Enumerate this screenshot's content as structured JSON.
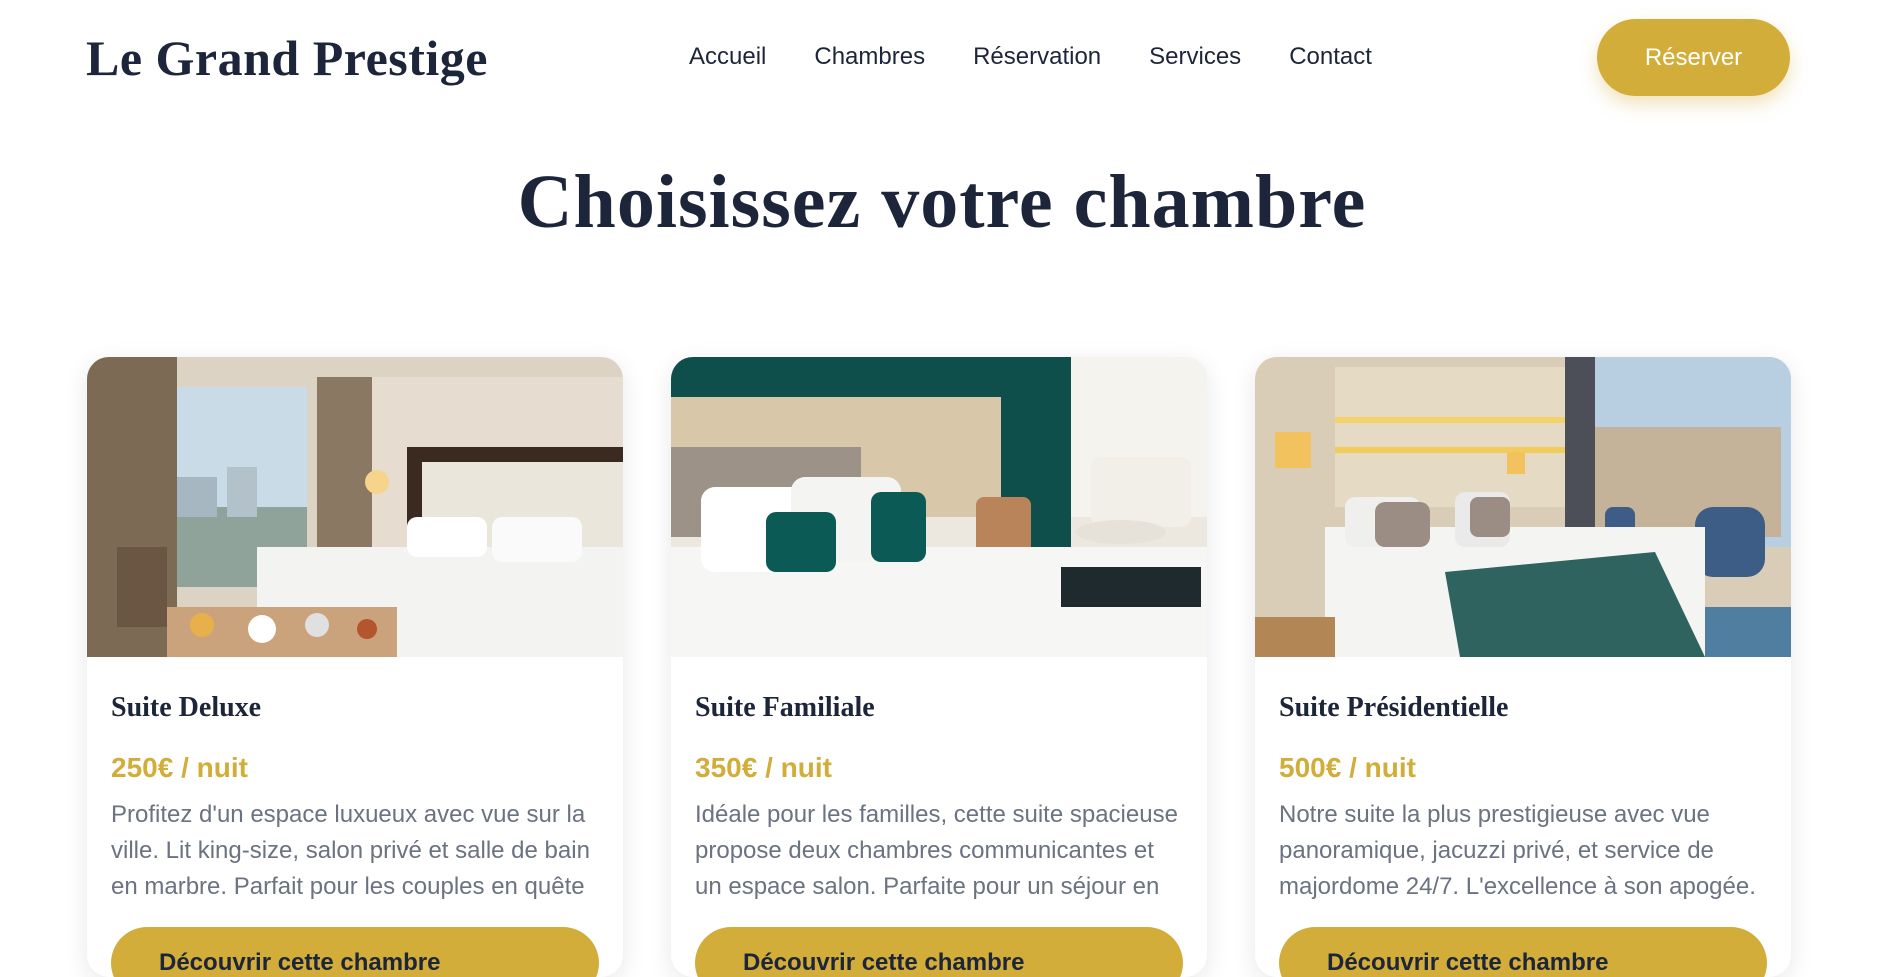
{
  "brand": {
    "name": "Le Grand Prestige"
  },
  "nav": {
    "items": [
      {
        "label": "Accueil"
      },
      {
        "label": "Chambres"
      },
      {
        "label": "Réservation"
      },
      {
        "label": "Services"
      },
      {
        "label": "Contact"
      }
    ],
    "cta_label": "Réserver"
  },
  "page": {
    "title": "Choisissez votre chambre"
  },
  "rooms": [
    {
      "name": "Suite Deluxe",
      "price": "250€ / nuit",
      "description": "Profitez d'un espace luxueux avec vue sur la ville. Lit king-size, salon privé et salle de bain en marbre. Parfait pour les couples en quête",
      "button_label": "Découvrir cette chambre"
    },
    {
      "name": "Suite Familiale",
      "price": "350€ / nuit",
      "description": "Idéale pour les familles, cette suite spacieuse propose deux chambres communicantes et un espace salon. Parfaite pour un séjour en",
      "button_label": "Découvrir cette chambre"
    },
    {
      "name": "Suite Présidentielle",
      "price": "500€ / nuit",
      "description": "Notre suite la plus prestigieuse avec vue panoramique, jacuzzi privé, et service de majordome 24/7. L'excellence à son apogée.",
      "button_label": "Découvrir cette chambre"
    }
  ],
  "colors": {
    "accent": "#d3ad3a",
    "ink": "#1c2539",
    "muted": "#6b7280"
  }
}
